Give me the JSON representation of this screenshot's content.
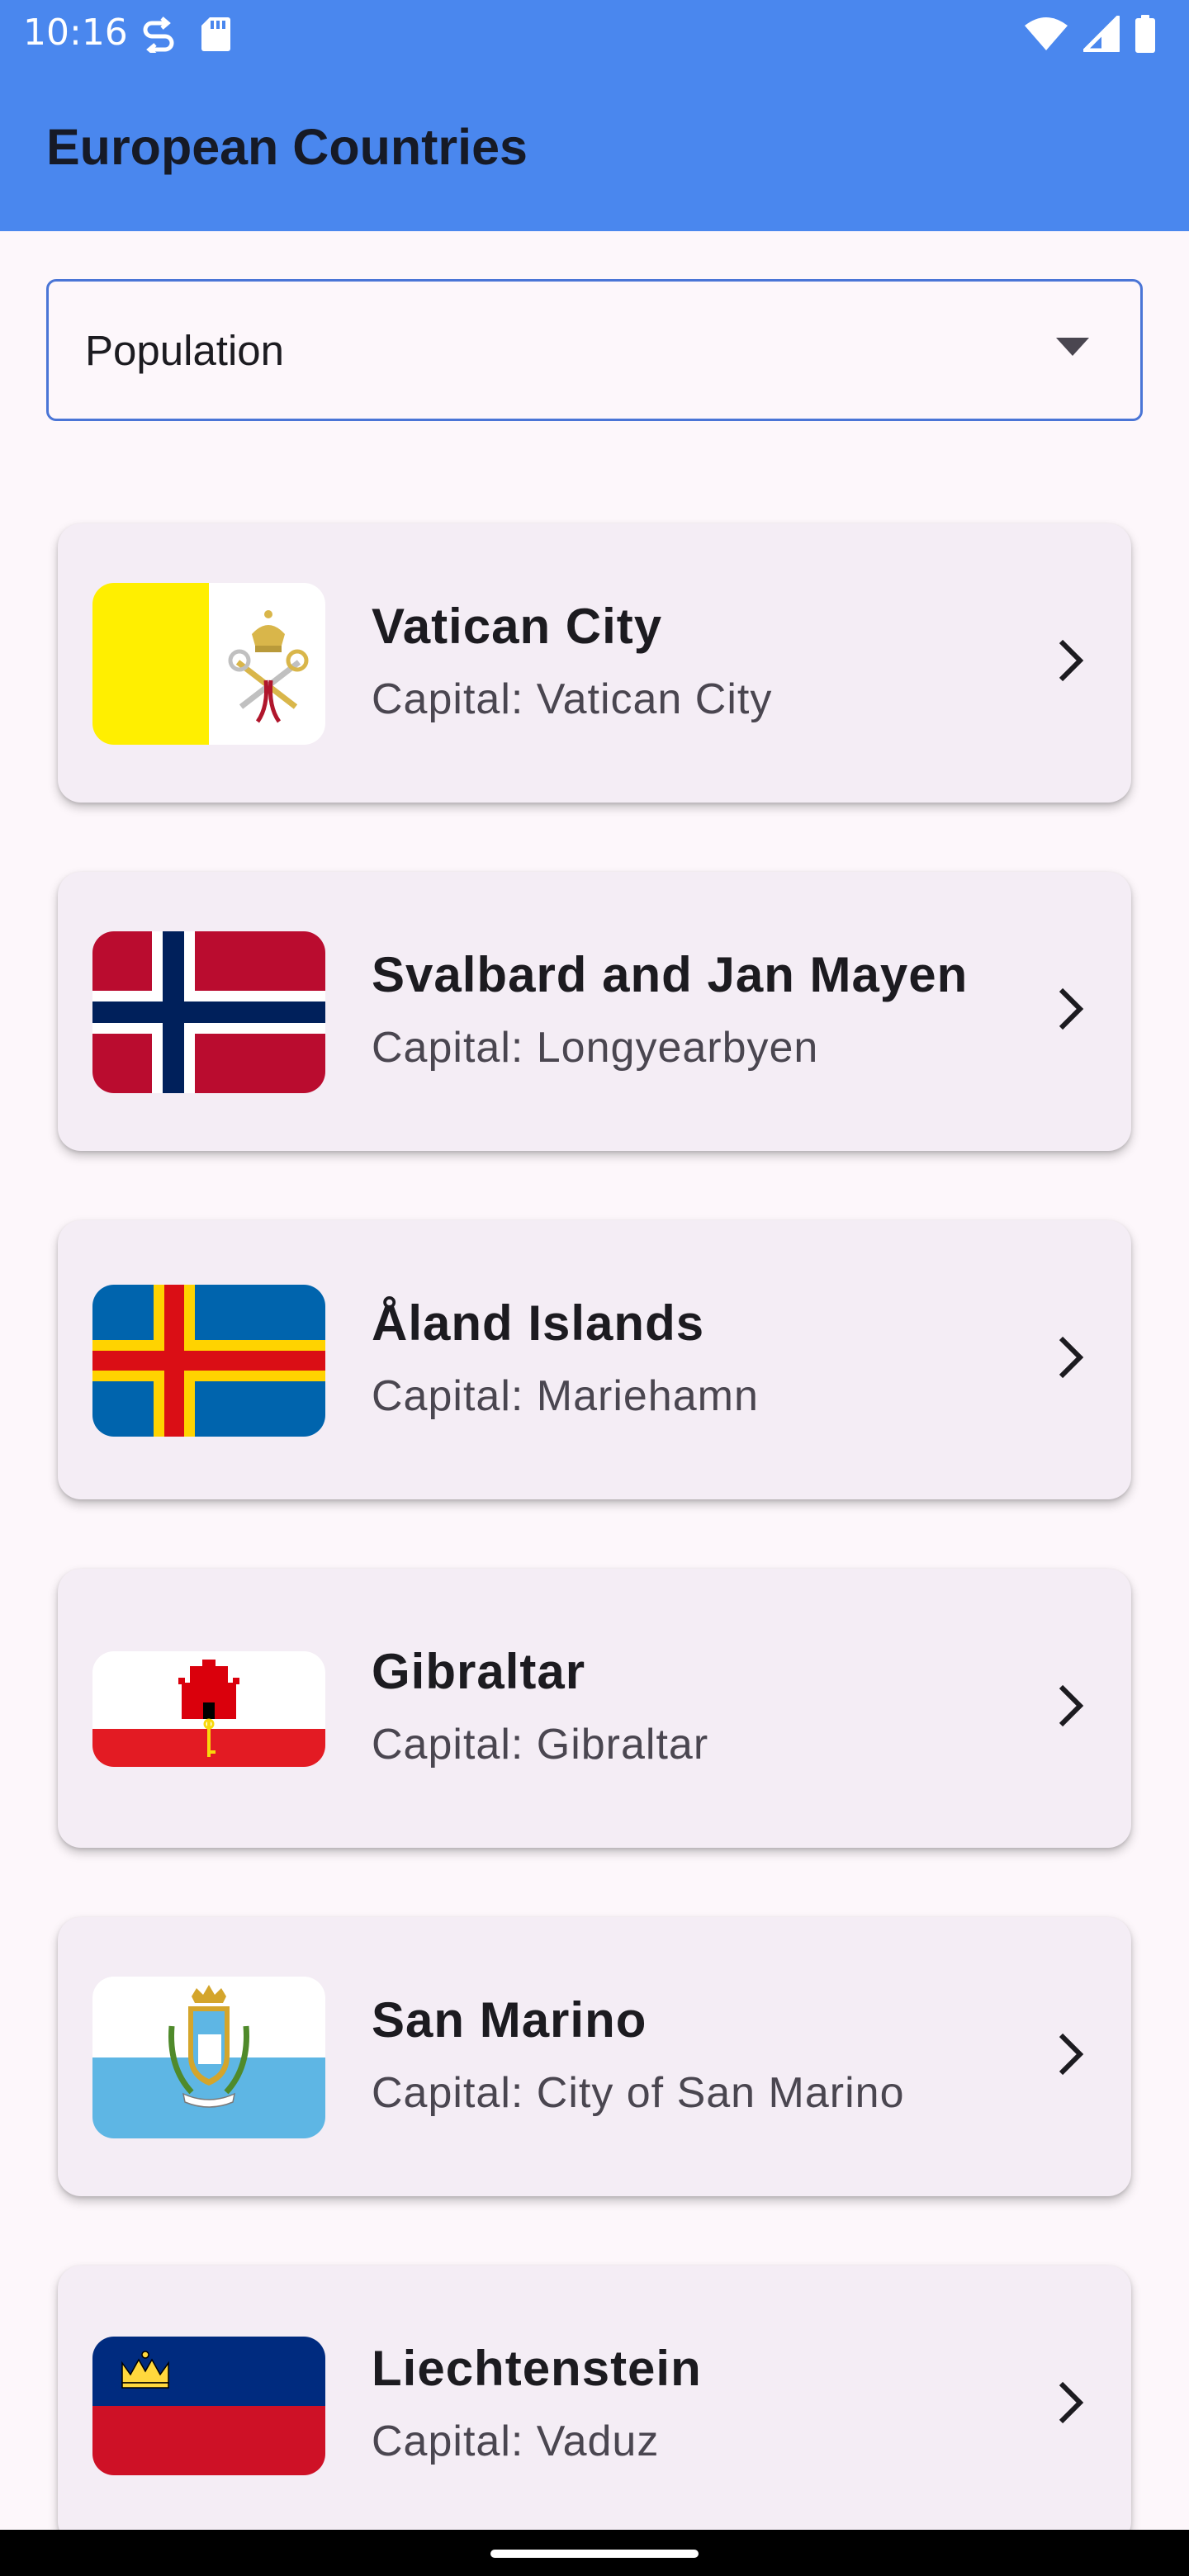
{
  "status_bar": {
    "time": "10:16",
    "icons_left": [
      "sync-icon",
      "sd-card-icon"
    ],
    "icons_right": [
      "wifi-icon",
      "signal-icon",
      "battery-icon"
    ]
  },
  "app_bar": {
    "title": "European Countries"
  },
  "sort_dropdown": {
    "selected": "Population",
    "icon": "arrow-drop-down-icon"
  },
  "countries": [
    {
      "name": "Vatican City",
      "capital": "Capital: Vatican City",
      "flag": "vatican-city-flag"
    },
    {
      "name": "Svalbard and Jan Mayen",
      "capital": "Capital: Longyearbyen",
      "flag": "svalbard-and-jan-mayen-flag"
    },
    {
      "name": "Åland Islands",
      "capital": "Capital: Mariehamn",
      "flag": "aland-islands-flag"
    },
    {
      "name": "Gibraltar",
      "capital": "Capital: Gibraltar",
      "flag": "gibraltar-flag"
    },
    {
      "name": "San Marino",
      "capital": "Capital: City of San Marino",
      "flag": "san-marino-flag"
    },
    {
      "name": "Liechtenstein",
      "capital": "Capital: Vaduz",
      "flag": "liechtenstein-flag"
    }
  ],
  "colors": {
    "app_bar": "#4a87ee",
    "background": "#fdf7fb",
    "card": "#f4edf5",
    "dropdown_border": "#4a75d6"
  }
}
